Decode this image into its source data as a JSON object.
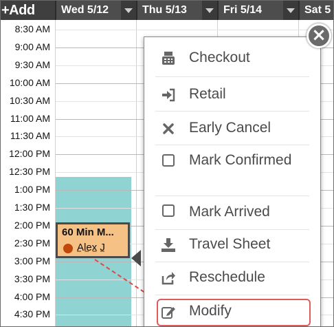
{
  "toolbar": {
    "add_label": "+Add"
  },
  "days": [
    {
      "label": "Wed 5/12"
    },
    {
      "label": "Thu 5/13"
    },
    {
      "label": "Fri 5/14"
    },
    {
      "label": "Sat 5"
    }
  ],
  "times": [
    "8:30 AM",
    "9:00 AM",
    "9:30 AM",
    "10:00 AM",
    "10:30 AM",
    "11:00 AM",
    "11:30 AM",
    "12:00 PM",
    "12:30 PM",
    "1:00 PM",
    "1:30 PM",
    "2:00 PM",
    "2:30 PM",
    "3:00 PM",
    "3:30 PM",
    "4:00 PM",
    "4:30 PM"
  ],
  "appointment": {
    "title": "60 Min M...",
    "person": "Alex J",
    "color": "#f6c184",
    "status_color": "#c0480d"
  },
  "menu": {
    "items": [
      {
        "label": "Checkout",
        "icon": "cash-register-icon"
      },
      {
        "label": "Retail",
        "icon": "sign-in-icon"
      },
      {
        "label": "Early Cancel",
        "icon": "x-icon"
      },
      {
        "label": "Mark Confirmed",
        "icon": "checkbox-icon"
      },
      {
        "label": "Mark Arrived",
        "icon": "checkbox-icon"
      },
      {
        "label": "Travel Sheet",
        "icon": "download-icon"
      },
      {
        "label": "Reschedule",
        "icon": "share-icon"
      },
      {
        "label": "Modify",
        "icon": "edit-icon"
      }
    ]
  },
  "colors": {
    "header": "#3f3f3f",
    "availability": "#8fd3d3",
    "highlight": "#e05a5a"
  }
}
